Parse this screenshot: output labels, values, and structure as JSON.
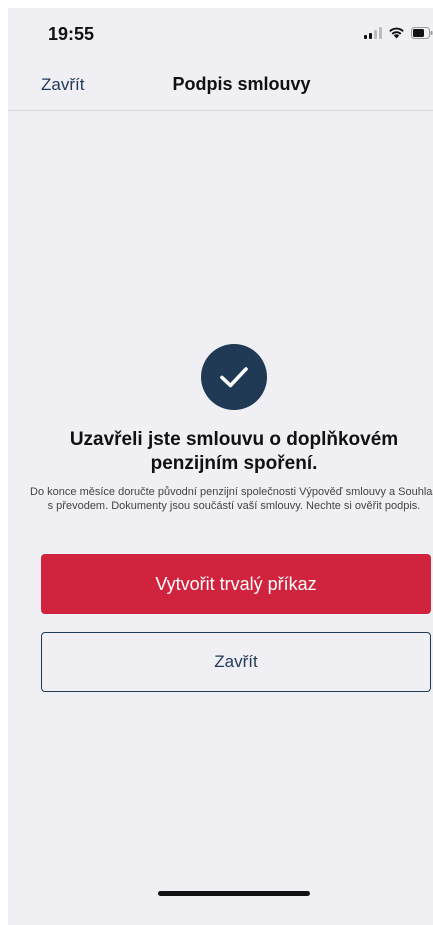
{
  "status_bar": {
    "time": "19:55",
    "icons": [
      "signal-icon",
      "wifi-icon",
      "battery-icon"
    ]
  },
  "nav": {
    "close_label": "Zavřít",
    "title": "Podpis smlouvy"
  },
  "content": {
    "icon": "checkmark-circle-icon",
    "headline": "Uzavřeli jste smlouvu o doplňkovém penzijním spoření.",
    "description": "Do konce měsíce doručte původní penzijní společnosti Výpověď smlouvy a Souhlas s převodem. Dokumenty jsou součástí vaší smlouvy. Nechte si ověřit podpis."
  },
  "actions": {
    "primary_label": "Vytvořit trvalý příkaz",
    "secondary_label": "Zavřít"
  },
  "colors": {
    "background": "#efeff4",
    "accent_red": "#d0243e",
    "navy": "#1f3a57",
    "icon_circle": "#203a55"
  }
}
